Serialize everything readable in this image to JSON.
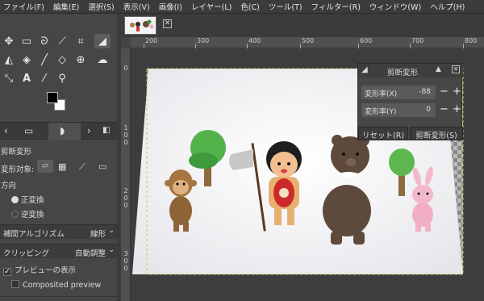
{
  "menubar": [
    "ファイル(F)",
    "編集(E)",
    "選択(S)",
    "表示(V)",
    "画像(I)",
    "レイヤー(L)",
    "色(C)",
    "ツール(T)",
    "フィルター(R)",
    "ウィンドウ(W)",
    "ヘルプ(H)"
  ],
  "rulers": {
    "horizontal": [
      "200",
      "300",
      "400",
      "500",
      "600",
      "700",
      "800"
    ],
    "vertical": [
      "0",
      "1",
      "0",
      "0",
      "2",
      "0",
      "0",
      "3",
      "0",
      "0"
    ]
  },
  "tool_options": {
    "title": "剪断変形",
    "transform_label": "変形対象:",
    "direction_label": "方向",
    "direction_forward": "正変換",
    "direction_backward": "逆変換",
    "interpolation_label": "補間アルゴリズム",
    "interpolation_value": "線形",
    "clipping_label": "クリッピング",
    "clipping_value": "自動調整",
    "preview_label": "プレビューの表示",
    "composited_label": "Composited preview"
  },
  "shear_dialog": {
    "title": "剪断変形",
    "x_label": "変形率(X)",
    "x_value": "-88",
    "y_label": "変形率(Y)",
    "y_value": "0",
    "reset_label": "リセット(R)",
    "apply_label": "剪断変形(S)"
  }
}
